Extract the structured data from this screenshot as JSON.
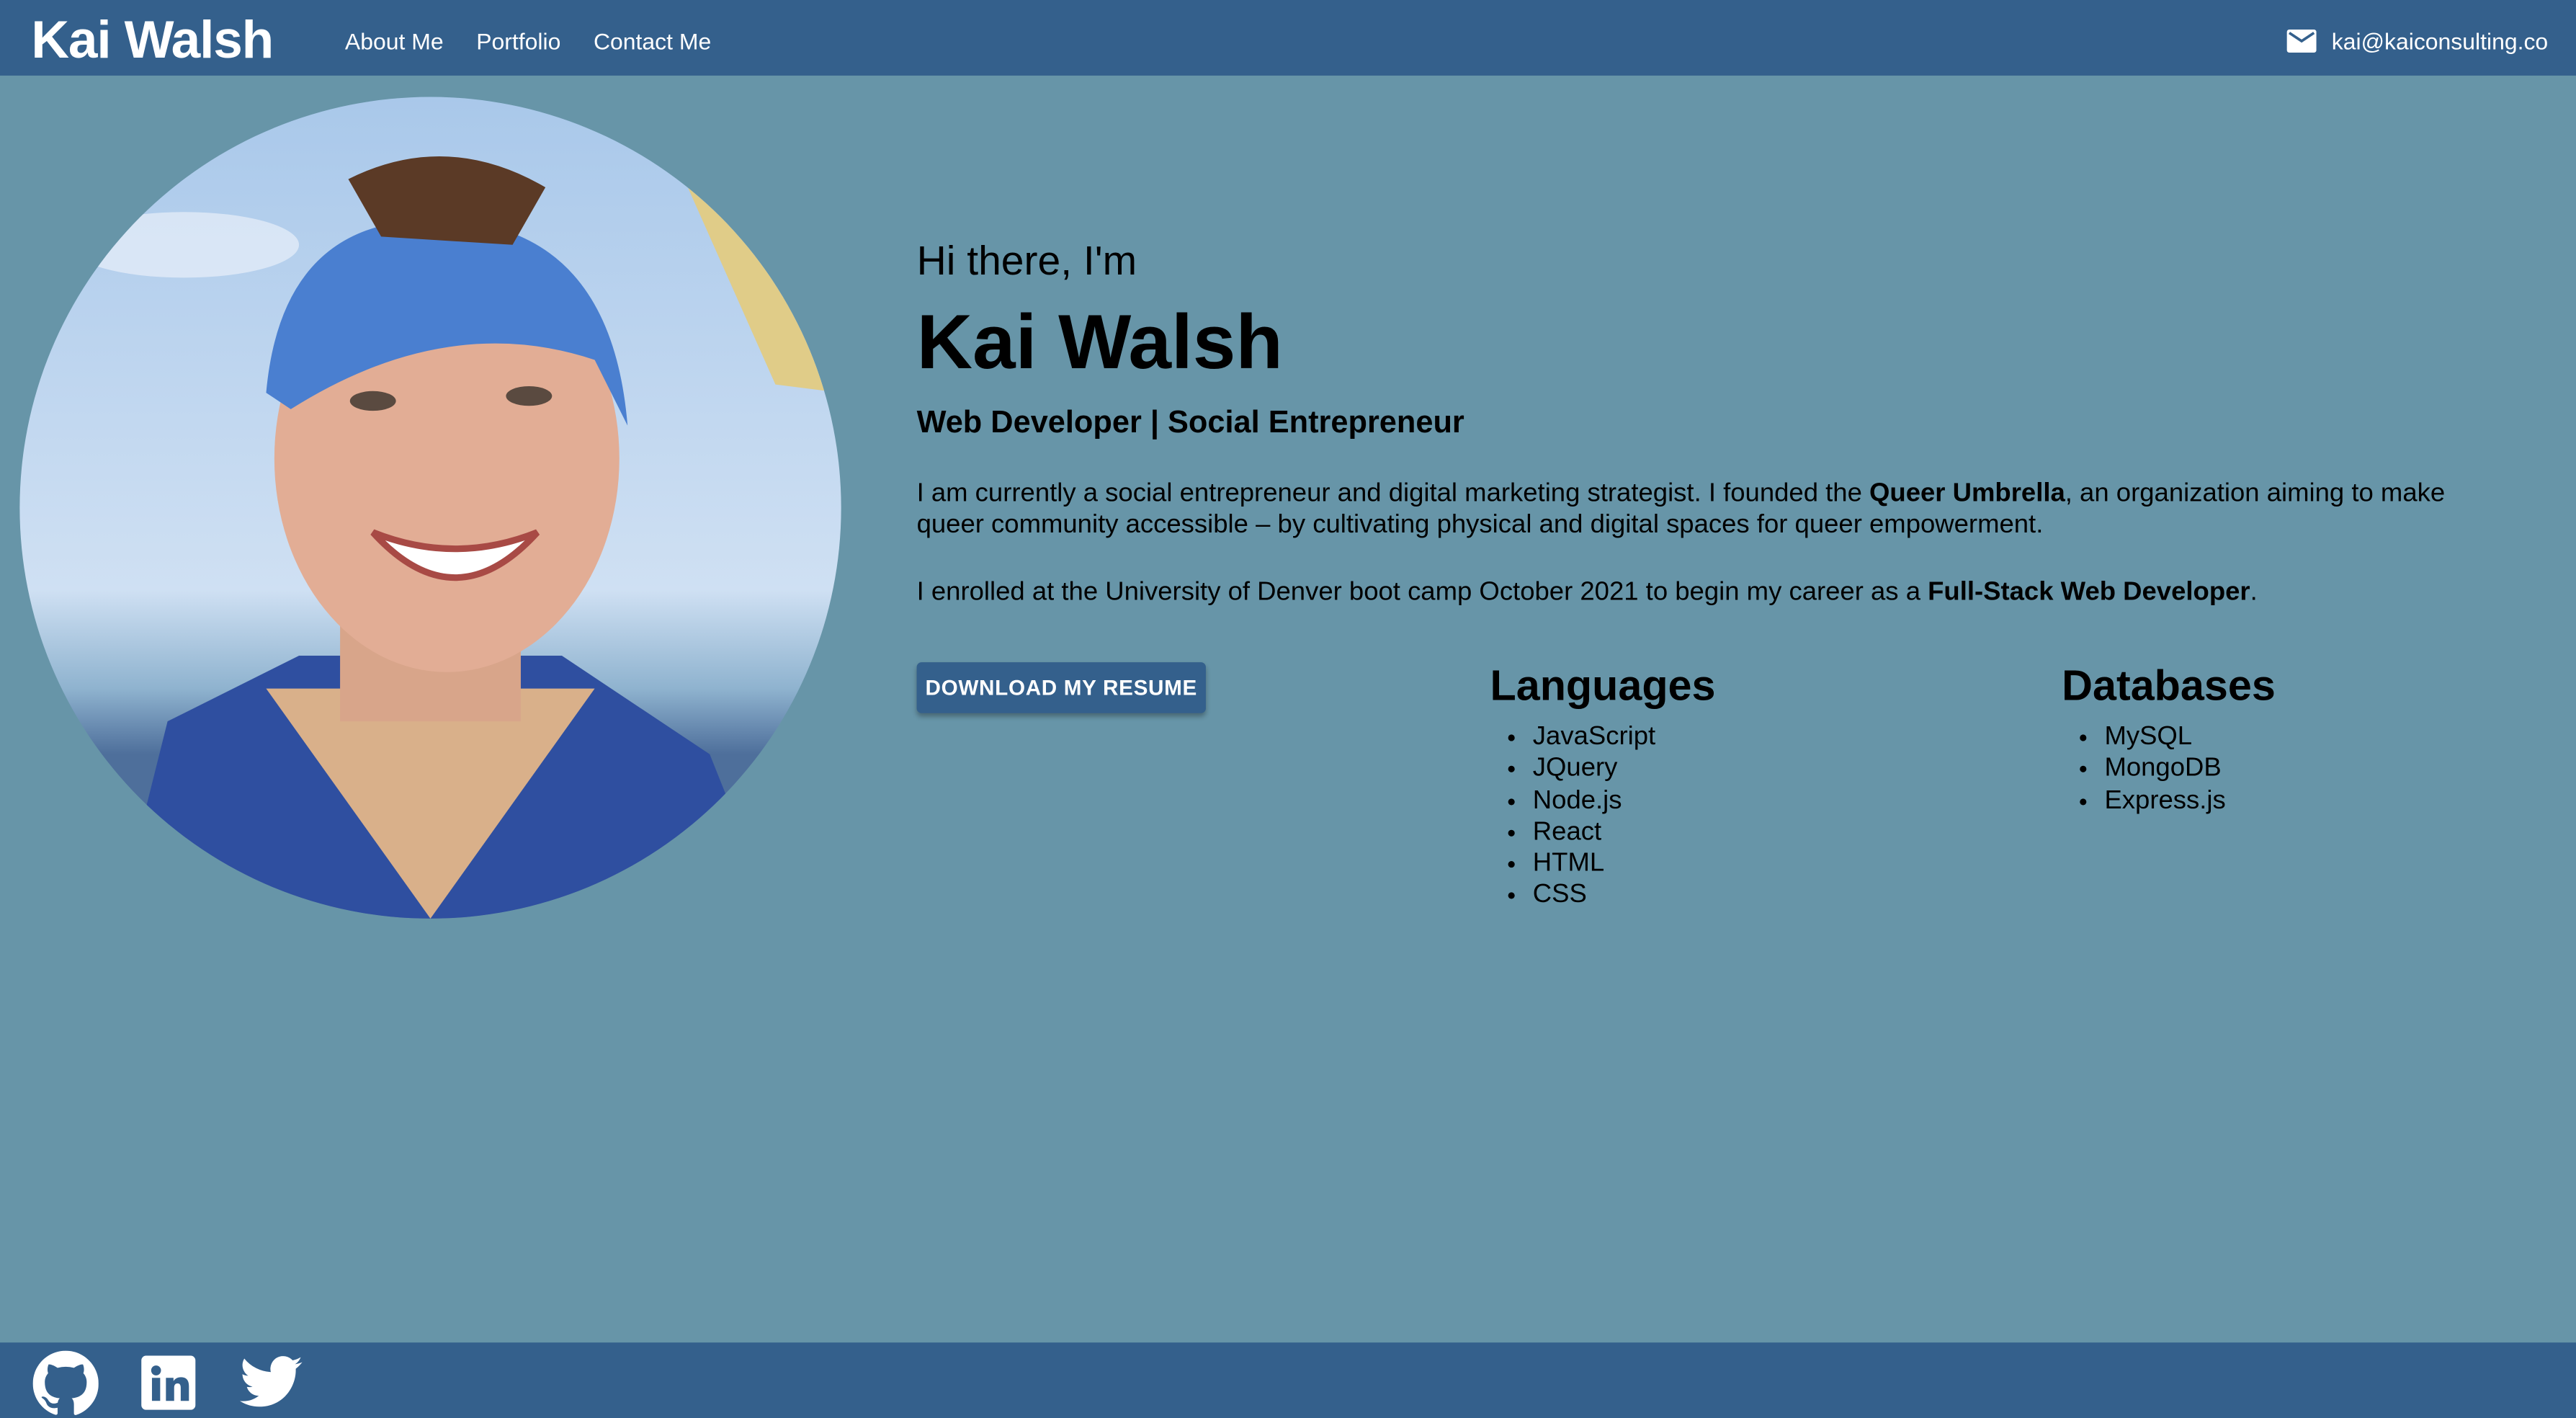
{
  "nav": {
    "brand": "Kai Walsh",
    "links": [
      "About Me",
      "Portfolio",
      "Contact Me"
    ],
    "email": "kai@kaiconsulting.co"
  },
  "hero": {
    "greeting": "Hi there, I'm",
    "name": "Kai Walsh",
    "role": "Web Developer | Social Entrepreneur",
    "para1_a": "I am currently a social entrepreneur and digital marketing strategist. I founded the ",
    "para1_b": "Queer Umbrella",
    "para1_c": ", an organization aiming to make queer community accessible – by cultivating physical and digital spaces for queer empowerment.",
    "para2_a": "I enrolled at the University of Denver boot camp October 2021 to begin my career as a ",
    "para2_b": "Full-Stack Web Developer",
    "para2_c": ".",
    "resume_button": "DOWNLOAD MY RESUME"
  },
  "languages": {
    "title": "Languages",
    "items": [
      "JavaScript",
      "JQuery",
      "Node.js",
      "React",
      "HTML",
      "CSS"
    ]
  },
  "databases": {
    "title": "Databases",
    "items": [
      "MySQL",
      "MongoDB",
      "Express.js"
    ]
  },
  "footer": {
    "icons": [
      "github-icon",
      "linkedin-icon",
      "twitter-icon"
    ]
  },
  "colors": {
    "nav": "#34608c",
    "background": "#6795a8"
  }
}
